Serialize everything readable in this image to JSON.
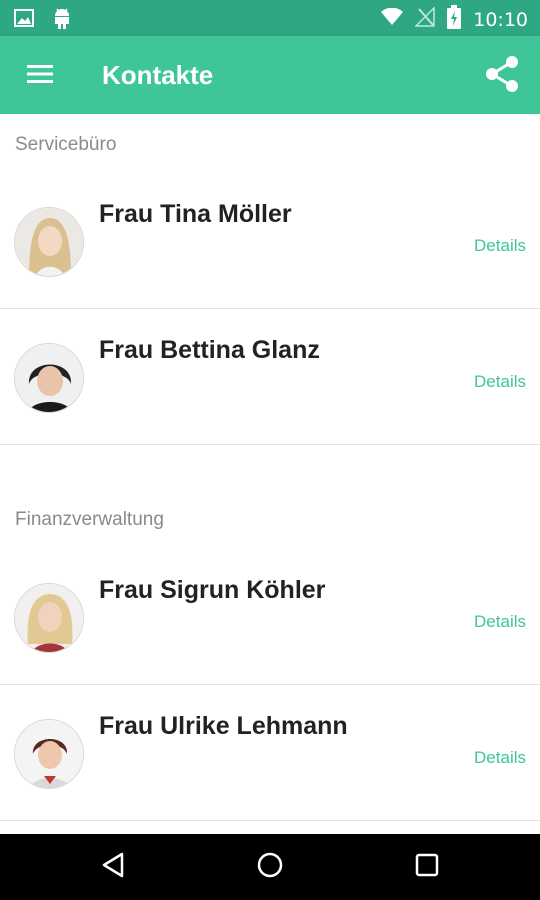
{
  "status_bar": {
    "time": "10:10"
  },
  "appbar": {
    "title": "Kontakte"
  },
  "sections": [
    {
      "title": "Servicebüro",
      "contacts": [
        {
          "name": "Frau Tina Möller",
          "details": "Details"
        },
        {
          "name": "Frau Bettina Glanz",
          "details": "Details"
        }
      ]
    },
    {
      "title": "Finanzverwaltung",
      "contacts": [
        {
          "name": "Frau Sigrun Köhler",
          "details": "Details"
        },
        {
          "name": "Frau Ulrike Lehmann",
          "details": "Details"
        }
      ]
    }
  ],
  "colors": {
    "primary": "#3ec699",
    "primary_dark": "#2ea882",
    "accent_text": "#3ec699"
  },
  "icons": {
    "status_left": [
      "image-icon",
      "android-icon"
    ],
    "status_right": [
      "wifi-icon",
      "no-signal-icon",
      "battery-charging-icon"
    ],
    "appbar": [
      "menu-icon",
      "share-icon"
    ],
    "navigation": [
      "back-icon",
      "home-icon",
      "recents-icon"
    ]
  }
}
